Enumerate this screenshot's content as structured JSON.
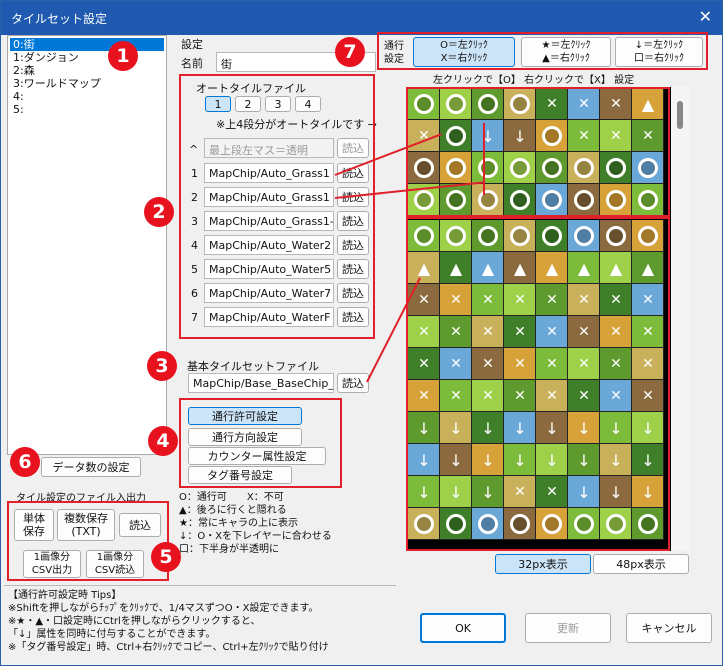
{
  "window": {
    "title": "タイルセット設定",
    "close": "✕"
  },
  "tileset_list": {
    "items": [
      "0:街",
      "1:ダンジョン",
      "2:森",
      "3:ワールドマップ",
      "4:",
      "5:"
    ],
    "selected": 0
  },
  "settings": {
    "group_label": "設定",
    "name_label": "名前",
    "name_value": "街"
  },
  "autotile": {
    "label": "オートタイルファイル",
    "page_buttons": [
      "1",
      "2",
      "3",
      "4"
    ],
    "note": "※上4段分がオートタイルです →",
    "top_placeholder": "最上段左マス＝透明",
    "top_prefix": "^",
    "load_label": "読込",
    "rows": [
      {
        "num": "1",
        "file": "MapChip/Auto_Grass1"
      },
      {
        "num": "2",
        "file": "MapChip/Auto_Grass1"
      },
      {
        "num": "3",
        "file": "MapChip/Auto_Grass1-"
      },
      {
        "num": "4",
        "file": "MapChip/Auto_Water2"
      },
      {
        "num": "5",
        "file": "MapChip/Auto_Water5"
      },
      {
        "num": "6",
        "file": "MapChip/Auto_Water7"
      },
      {
        "num": "7",
        "file": "MapChip/Auto_WaterF"
      }
    ]
  },
  "base_tileset": {
    "label": "基本タイルセットファイル",
    "file": "MapChip/Base_BaseChip_",
    "load": "読込"
  },
  "setting_buttons": [
    "通行許可設定",
    "通行方向設定",
    "カウンター属性設定",
    "タグ番号設定"
  ],
  "data_count_button": "データ数の設定",
  "file_io": {
    "label": "タイル設定のファイル入出力",
    "single_save": "単体\n保存",
    "multi_save": "複数保存\n(TXT)",
    "load": "読込",
    "csv_out": "1画像分\nCSV出力",
    "csv_in": "1画像分\nCSV読込"
  },
  "legend": [
    "O：通行可　　X：不可",
    "▲：後ろに行くと隠れる",
    "★：常にキャラの上に表示",
    "↓：O・Xを下レイヤーに合わせる",
    "口：下半身が半透明に"
  ],
  "passage": {
    "label": "通行\n設定",
    "opt1": "O＝左ｸﾘｯｸ\nX＝右ｸﾘｯｸ",
    "opt2": "★＝左ｸﾘｯｸ\n▲＝右ｸﾘｯｸ",
    "opt3": "↓＝左ｸﾘｯｸ\n口＝右ｸﾘｯｸ",
    "hint": "左クリックで【O】 右クリックで【X】 設定"
  },
  "view_buttons": [
    "32px表示",
    "48px表示"
  ],
  "tips": {
    "title": "【通行許可設定時 Tips】",
    "lines": [
      "※Shiftを押しながらﾁｯﾌﾟをｸﾘｯｸで、1/4マスずつO・X設定できます。",
      "※★・▲・口設定時にCtrlを押しながらクリックすると、",
      "「↓」属性を同時に付与することができます。",
      "※「タグ番号設定」時、Ctrl+右ｸﾘｯｸでコピー、Ctrl+左ｸﾘｯｸで貼り付け"
    ]
  },
  "dialog_buttons": {
    "ok": "OK",
    "update": "更新",
    "cancel": "キャンセル"
  },
  "badges": [
    "1",
    "2",
    "3",
    "4",
    "5",
    "6",
    "7"
  ],
  "accent": "#e0202a",
  "tiles": {
    "auto": [
      [
        "o",
        "o",
        "o",
        "o",
        "x",
        "x",
        "x",
        "a"
      ],
      [
        "x",
        "o",
        "d",
        "d",
        "o",
        "x",
        "x",
        "x"
      ],
      [
        "o",
        "o",
        "o",
        "o",
        "o",
        "o",
        "o",
        "o"
      ],
      [
        "o",
        "o",
        "o",
        "o",
        "o",
        "o",
        "o",
        "o"
      ]
    ],
    "base": [
      [
        "o",
        "o",
        "o",
        "o",
        "o",
        "o",
        "o",
        "o"
      ],
      [
        "a",
        "a",
        "a",
        "a",
        "a",
        "a",
        "a",
        "a"
      ],
      [
        "x",
        "x",
        "x",
        "x",
        "x",
        "x",
        "x",
        "x"
      ],
      [
        "x",
        "x",
        "x",
        "x",
        "x",
        "x",
        "x",
        "x"
      ],
      [
        "x",
        "x",
        "x",
        "x",
        "x",
        "x",
        "x",
        "x"
      ],
      [
        "x",
        "x",
        "x",
        "x",
        "x",
        "x",
        "x",
        "x"
      ],
      [
        "d",
        "d",
        "d",
        "d",
        "d",
        "d",
        "d",
        "d"
      ],
      [
        "d",
        "d",
        "d",
        "d",
        "d",
        "d",
        "d",
        "d"
      ],
      [
        "d",
        "d",
        "d",
        "x",
        "x",
        "d",
        "d",
        "d"
      ],
      [
        "o",
        "o",
        "o",
        "o",
        "o",
        "o",
        "o",
        "o"
      ]
    ]
  }
}
